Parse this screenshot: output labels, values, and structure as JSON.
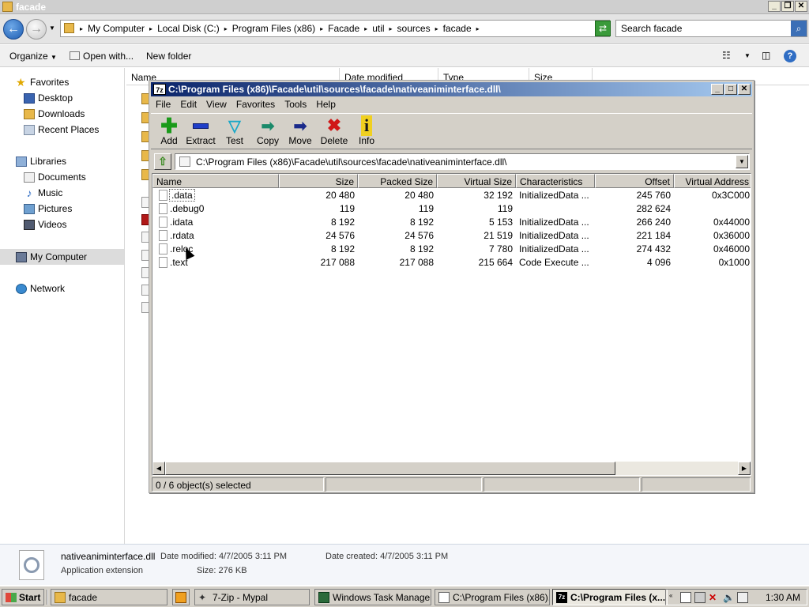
{
  "explorer": {
    "title": "facade",
    "breadcrumbs": [
      "My Computer",
      "Local Disk (C:)",
      "Program Files (x86)",
      "Facade",
      "util",
      "sources",
      "facade"
    ],
    "search_placeholder": "Search facade",
    "commands": {
      "organize": "Organize",
      "open_with": "Open with...",
      "new_folder": "New folder"
    },
    "nav": {
      "favorites": "Favorites",
      "desktop": "Desktop",
      "downloads": "Downloads",
      "recent": "Recent Places",
      "libraries": "Libraries",
      "documents": "Documents",
      "music": "Music",
      "pictures": "Pictures",
      "videos": "Videos",
      "my_computer": "My Computer",
      "network": "Network"
    },
    "columns": [
      "Name",
      "Date modified",
      "Type",
      "Size"
    ],
    "details": {
      "file_name": "nativeaniminterface.dll",
      "date_modified": "Date modified:  4/7/2005 3:11 PM",
      "date_created": "Date created:  4/7/2005 3:11 PM",
      "type": "Application extension",
      "size": "Size:  276 KB"
    }
  },
  "zip": {
    "title": "C:\\Program Files (x86)\\Facade\\util\\sources\\facade\\nativeaniminterface.dll\\",
    "menu": [
      "File",
      "Edit",
      "View",
      "Favorites",
      "Tools",
      "Help"
    ],
    "tools": {
      "add": "Add",
      "extract": "Extract",
      "test": "Test",
      "copy": "Copy",
      "move": "Move",
      "delete": "Delete",
      "info": "Info"
    },
    "path": "C:\\Program Files (x86)\\Facade\\util\\sources\\facade\\nativeaniminterface.dll\\",
    "columns": {
      "name": "Name",
      "size": "Size",
      "packed": "Packed Size",
      "virtual": "Virtual Size",
      "chars": "Characteristics",
      "offset": "Offset",
      "vaddr": "Virtual Address"
    },
    "rows": [
      {
        "name": ".data",
        "size": "20 480",
        "packed": "20 480",
        "virtual": "32 192",
        "chars": "InitializedData ...",
        "offset": "245 760",
        "vaddr": "0x3C000"
      },
      {
        "name": ".debug0",
        "size": "119",
        "packed": "119",
        "virtual": "119",
        "chars": "",
        "offset": "282 624",
        "vaddr": ""
      },
      {
        "name": ".idata",
        "size": "8 192",
        "packed": "8 192",
        "virtual": "5 153",
        "chars": "InitializedData ...",
        "offset": "266 240",
        "vaddr": "0x44000"
      },
      {
        "name": ".rdata",
        "size": "24 576",
        "packed": "24 576",
        "virtual": "21 519",
        "chars": "InitializedData ...",
        "offset": "221 184",
        "vaddr": "0x36000"
      },
      {
        "name": ".reloc",
        "size": "8 192",
        "packed": "8 192",
        "virtual": "7 780",
        "chars": "InitializedData ...",
        "offset": "274 432",
        "vaddr": "0x46000"
      },
      {
        "name": ".text",
        "size": "217 088",
        "packed": "217 088",
        "virtual": "215 664",
        "chars": "Code Execute ...",
        "offset": "4 096",
        "vaddr": "0x1000"
      }
    ],
    "status": "0 / 6 object(s) selected"
  },
  "taskbar": {
    "start": "Start",
    "buttons": [
      "facade",
      "7-Zip - Mypal",
      "Windows Task Manager",
      "C:\\Program Files (x86)...",
      "C:\\Program Files (x..."
    ],
    "clock": "1:30 AM"
  }
}
